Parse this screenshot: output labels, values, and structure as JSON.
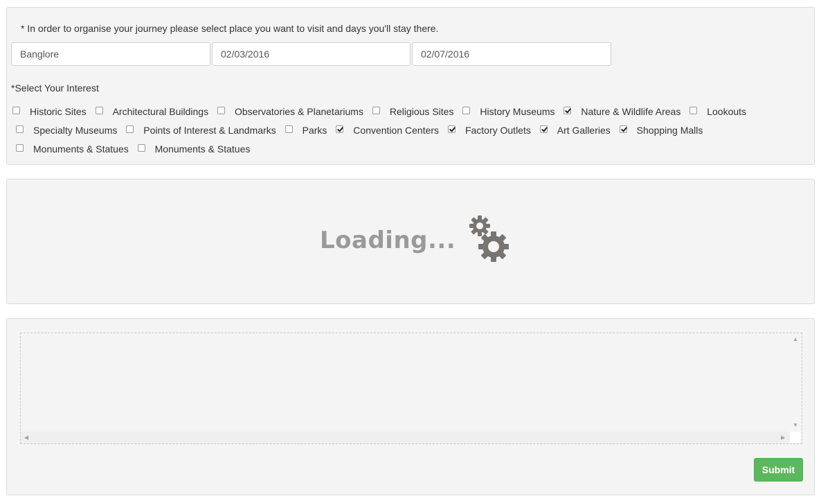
{
  "form": {
    "instruction": "* In order to organise your journey please select place you want to visit and days you'll stay there.",
    "place": "Banglore",
    "start_date": "02/03/2016",
    "end_date": "02/07/2016",
    "interest_title": "*Select Your Interest",
    "interests": [
      {
        "label": "Historic Sites",
        "checked": false
      },
      {
        "label": "Architectural Buildings",
        "checked": false
      },
      {
        "label": "Observatories & Planetariums",
        "checked": false
      },
      {
        "label": "Religious Sites",
        "checked": false
      },
      {
        "label": "History Museums",
        "checked": false
      },
      {
        "label": "Nature & Wildlife Areas",
        "checked": true
      },
      {
        "label": "Lookouts",
        "checked": false
      },
      {
        "label": "Specialty Museums",
        "checked": false
      },
      {
        "label": "Points of Interest & Landmarks",
        "checked": false
      },
      {
        "label": "Parks",
        "checked": false
      },
      {
        "label": "Convention Centers",
        "checked": true
      },
      {
        "label": "Factory Outlets",
        "checked": true
      },
      {
        "label": "Art Galleries",
        "checked": true
      },
      {
        "label": "Shopping Malls",
        "checked": true
      },
      {
        "label": "Monuments & Statues",
        "checked": false
      },
      {
        "label": "Monuments & Statues",
        "checked": false
      }
    ]
  },
  "loading": {
    "text": "Loading...",
    "icon": "gears-icon",
    "icon_color": "#7a7470"
  },
  "editor": {
    "submit_label": "Submit",
    "submit_color": "#5cb85c"
  }
}
